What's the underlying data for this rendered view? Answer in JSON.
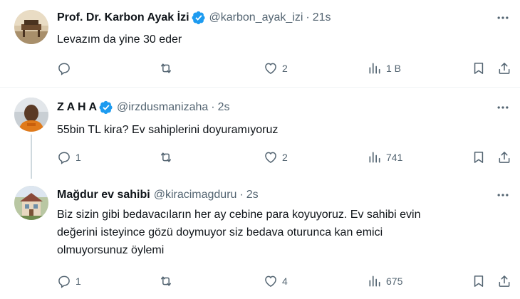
{
  "tweets": [
    {
      "name": "Prof. Dr. Karbon Ayak İzi",
      "handle": "@karbon_ayak_izi",
      "sep": "·",
      "time": "21s",
      "text": "Levazım da yine 30 eder",
      "replies": "",
      "retweets": "",
      "likes": "2",
      "views": "1 B"
    },
    {
      "name": "Z A H A",
      "handle": "@irzdusmanizaha",
      "sep": "·",
      "time": "2s",
      "text": "55bin TL kira? Ev sahiplerini doyuramıyoruz",
      "replies": "1",
      "retweets": "",
      "likes": "2",
      "views": "741"
    },
    {
      "name": "Mağdur ev sahibi",
      "handle": "@kiracimagduru",
      "sep": "·",
      "time": "2s",
      "text_lines": [
        "Biz sizin gibi bedavacıların her ay cebine para koyuyoruz. Ev sahibi evin",
        "değerini isteyince gözü doymuyor siz bedava oturunca kan emici",
        "olmuyorsunuz öylemi"
      ],
      "replies": "1",
      "retweets": "",
      "likes": "4",
      "views": "675"
    }
  ],
  "colors": {
    "accent": "#1d9bf0",
    "text": "#0f1419",
    "secondary": "#536471",
    "divider": "#eff3f4"
  },
  "icons": [
    "verified-badge-icon",
    "more-icon",
    "reply-icon",
    "retweet-icon",
    "like-icon",
    "views-icon",
    "bookmark-icon",
    "share-icon"
  ]
}
